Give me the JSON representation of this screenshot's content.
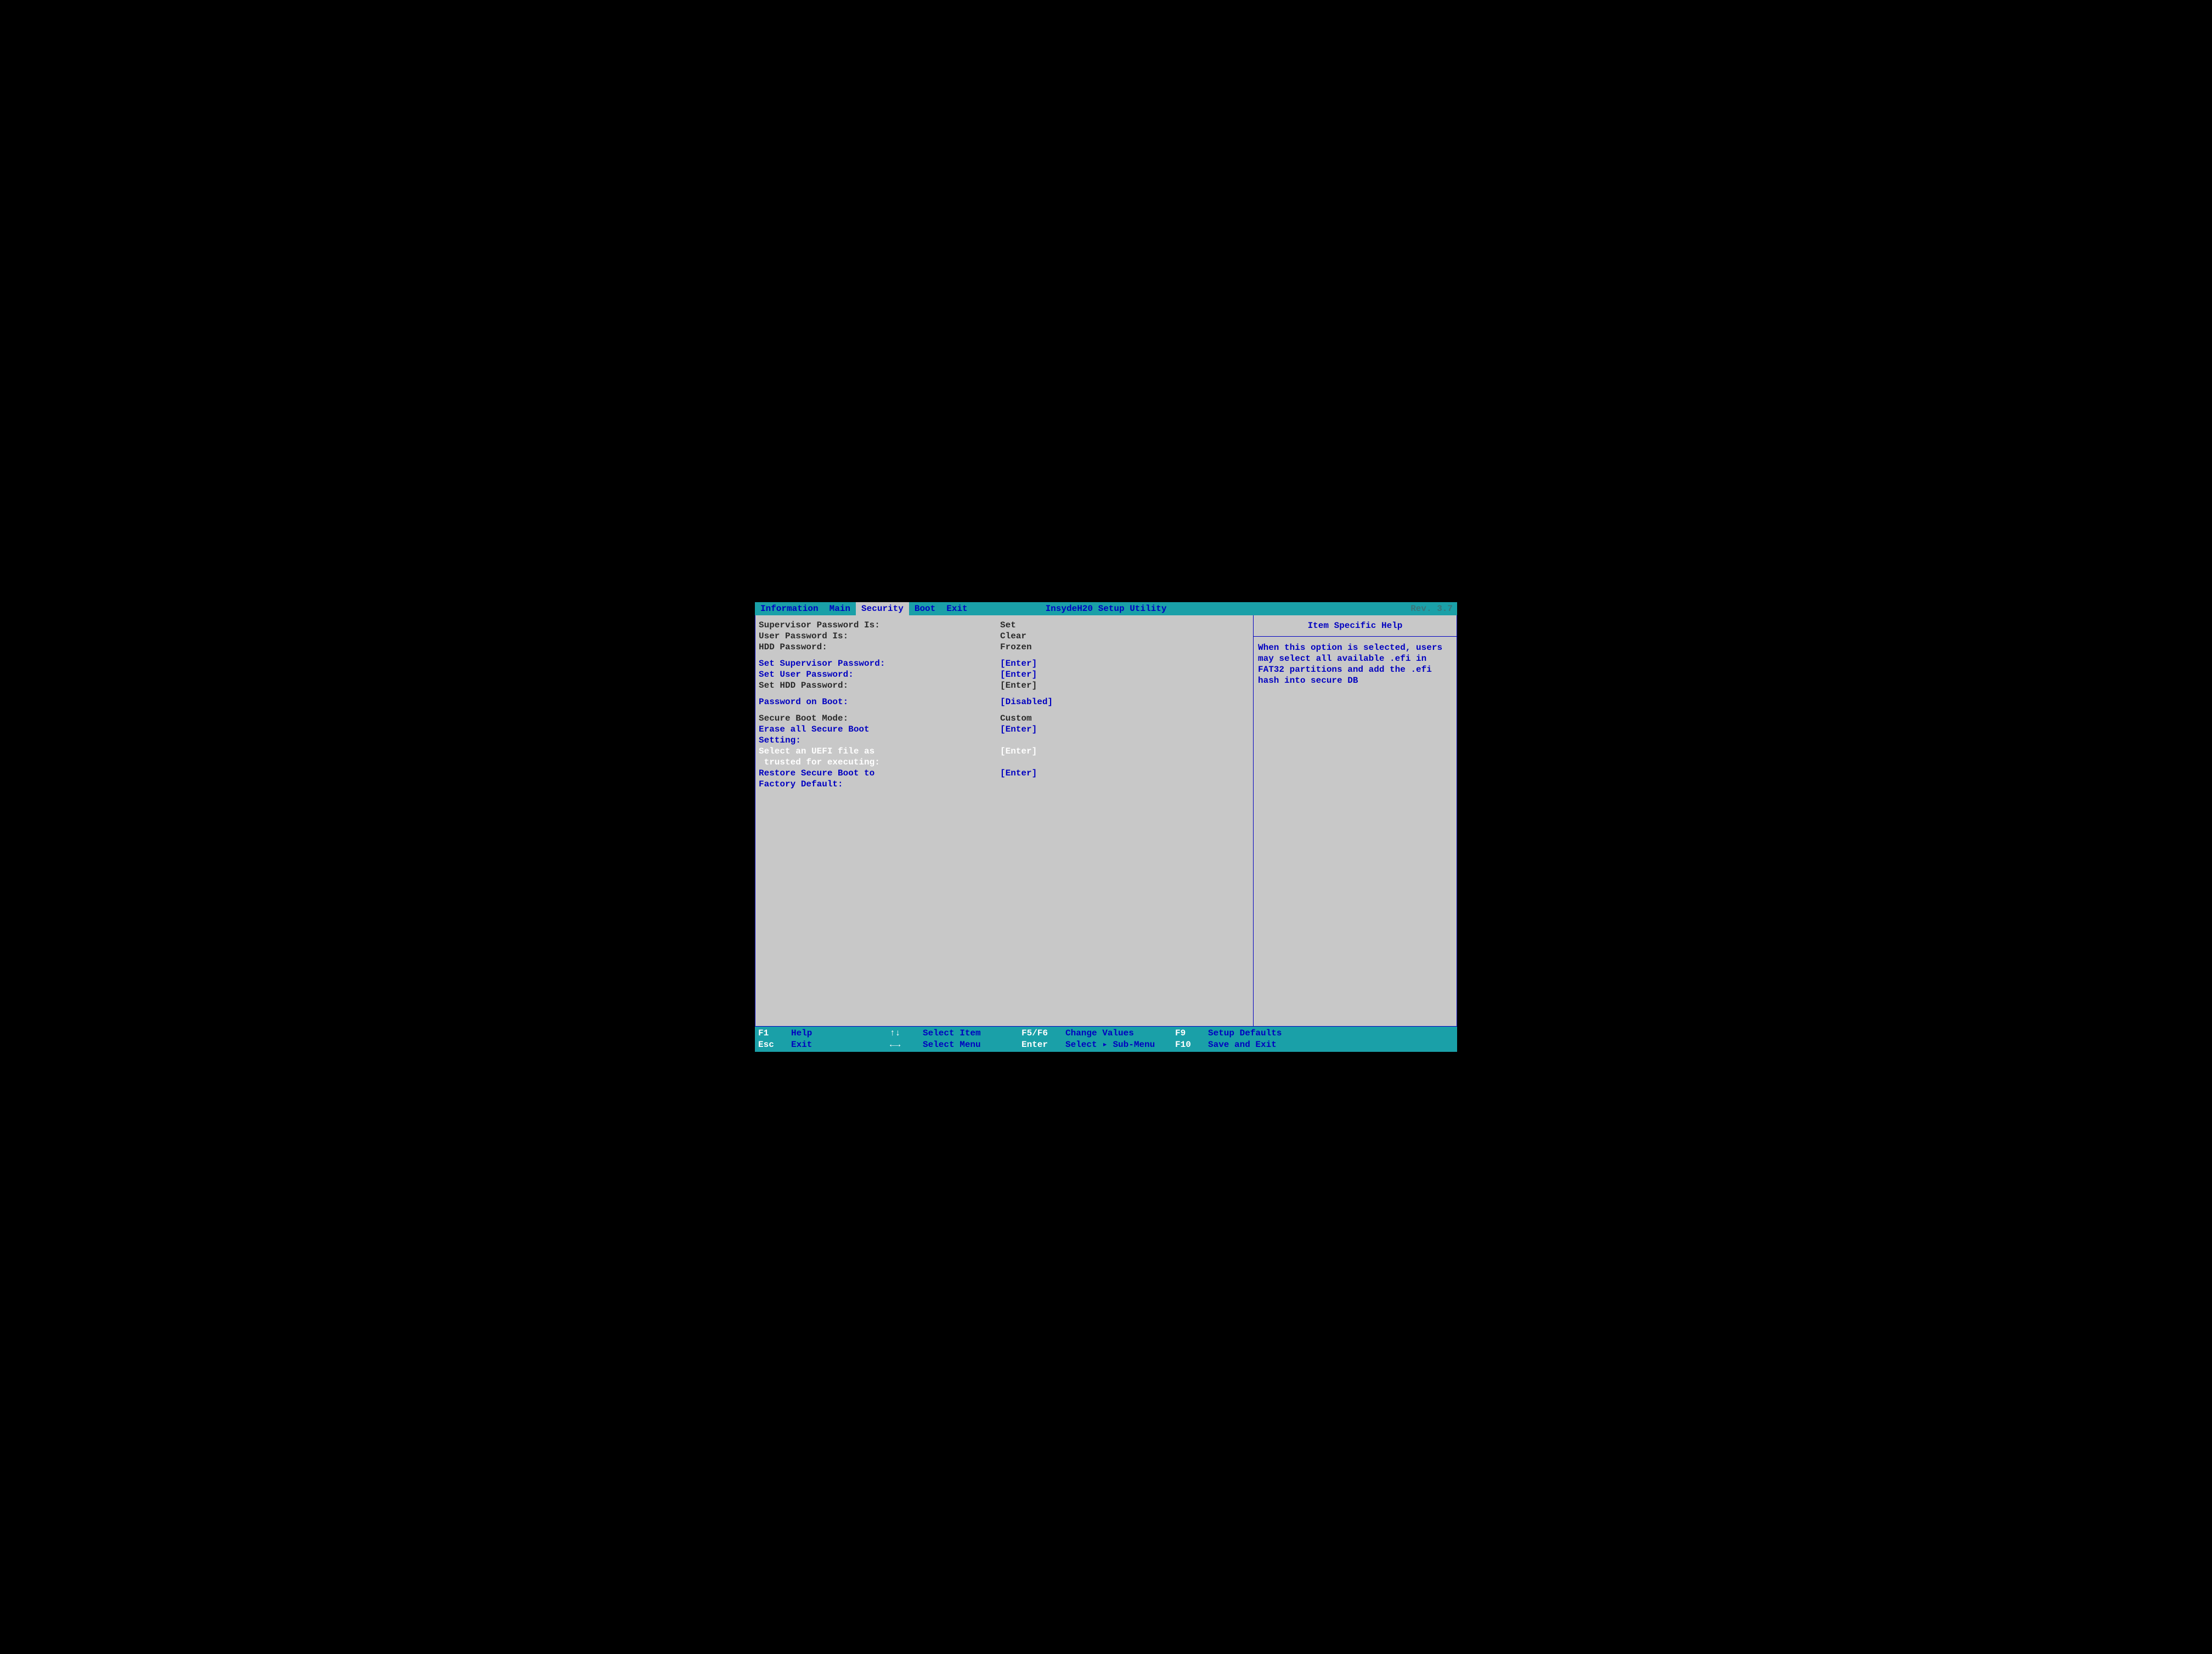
{
  "header": {
    "title": "InsydeH20 Setup Utility",
    "rev": "Rev. 3.7",
    "tabs": [
      {
        "label": "Information",
        "active": false
      },
      {
        "label": "Main",
        "active": false
      },
      {
        "label": "Security",
        "active": true
      },
      {
        "label": "Boot",
        "active": false
      },
      {
        "label": "Exit",
        "active": false
      }
    ]
  },
  "security": {
    "status": {
      "supervisor_label": "Supervisor Password Is:",
      "supervisor_value": "Set",
      "user_label": "User Password Is:",
      "user_value": "Clear",
      "hdd_label": "HDD Password:",
      "hdd_value": "Frozen"
    },
    "set_supervisor": {
      "label": "Set Supervisor Password:",
      "value": "[Enter]"
    },
    "set_user": {
      "label": "Set User Password:",
      "value": "[Enter]"
    },
    "set_hdd": {
      "label": "Set HDD Password:",
      "value": "[Enter]"
    },
    "pw_on_boot": {
      "label": "Password on Boot:",
      "value": "[Disabled]"
    },
    "sb_mode": {
      "label": "Secure Boot Mode:",
      "value": "Custom"
    },
    "erase_sb": {
      "label": "Erase all Secure Boot\nSetting:",
      "value": "[Enter]"
    },
    "select_uefi": {
      "label": "Select an UEFI file as\n trusted for executing:",
      "value": "[Enter]"
    },
    "restore_sb": {
      "label": "Restore Secure Boot to\nFactory Default:",
      "value": "[Enter]"
    }
  },
  "help": {
    "title": "Item Specific Help",
    "body": "When this option is selected, users may select all available .efi in FAT32 partitions and add the .efi hash into secure DB"
  },
  "footer": {
    "f1_k": "F1",
    "f1_d": "Help",
    "up_k": "↑↓",
    "up_d": "Select Item",
    "f5_k": "F5/F6",
    "f5_d": "Change Values",
    "f9_k": "F9",
    "f9_d": "Setup Defaults",
    "esc_k": "Esc",
    "esc_d": "Exit",
    "lr_k": "←→",
    "lr_d": "Select Menu",
    "en_k": "Enter",
    "en_d": "Select ▸ Sub-Menu",
    "f10_k": "F10",
    "f10_d": "Save and Exit"
  }
}
